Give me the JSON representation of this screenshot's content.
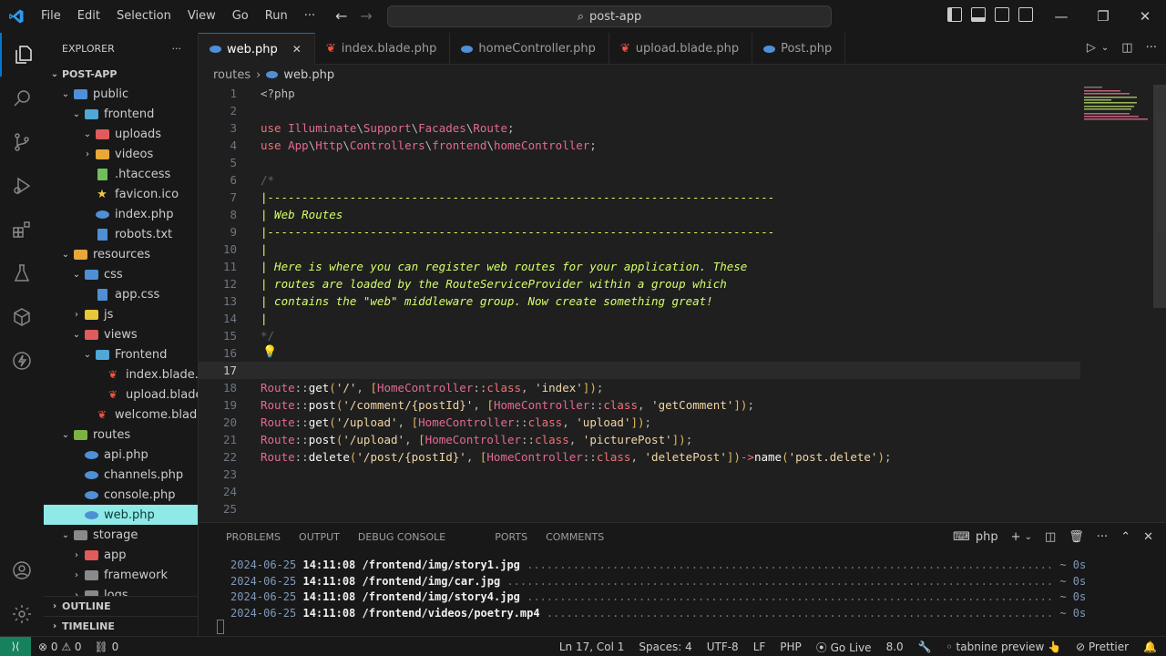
{
  "titlebar": {
    "menu": [
      "File",
      "Edit",
      "Selection",
      "View",
      "Go",
      "Run",
      "···"
    ],
    "search": "post-app"
  },
  "explorer": {
    "header": "EXPLORER",
    "more": "···",
    "project": "POST-APP",
    "tree": [
      {
        "label": "public",
        "kind": "folder-open",
        "indent": 1,
        "color": "#4f8fd6"
      },
      {
        "label": "frontend",
        "kind": "folder-open",
        "indent": 2,
        "color": "#4fa8d6"
      },
      {
        "label": "uploads",
        "kind": "folder-open",
        "indent": 3,
        "color": "#e05b5b"
      },
      {
        "label": "videos",
        "kind": "folder",
        "indent": 3,
        "color": "#e8a838"
      },
      {
        "label": ".htaccess",
        "kind": "file-ht",
        "indent": 3
      },
      {
        "label": "favicon.ico",
        "kind": "file-star",
        "indent": 3
      },
      {
        "label": "index.php",
        "kind": "file-php",
        "indent": 3
      },
      {
        "label": "robots.txt",
        "kind": "file-txt",
        "indent": 3
      },
      {
        "label": "resources",
        "kind": "folder-open",
        "indent": 1,
        "color": "#e8a838"
      },
      {
        "label": "css",
        "kind": "folder-open",
        "indent": 2,
        "color": "#4f8fd6"
      },
      {
        "label": "app.css",
        "kind": "file-css",
        "indent": 3
      },
      {
        "label": "js",
        "kind": "folder",
        "indent": 2,
        "color": "#e8c838"
      },
      {
        "label": "views",
        "kind": "folder-open",
        "indent": 2,
        "color": "#e05b5b"
      },
      {
        "label": "Frontend",
        "kind": "folder-open",
        "indent": 3,
        "color": "#4fa8d6"
      },
      {
        "label": "index.blade.p...",
        "kind": "file-blade",
        "indent": 4
      },
      {
        "label": "upload.blade....",
        "kind": "file-blade",
        "indent": 4
      },
      {
        "label": "welcome.blade...",
        "kind": "file-blade",
        "indent": 3
      },
      {
        "label": "routes",
        "kind": "folder-open",
        "indent": 1,
        "color": "#7cb342"
      },
      {
        "label": "api.php",
        "kind": "file-php",
        "indent": 2
      },
      {
        "label": "channels.php",
        "kind": "file-php",
        "indent": 2
      },
      {
        "label": "console.php",
        "kind": "file-php",
        "indent": 2
      },
      {
        "label": "web.php",
        "kind": "file-php",
        "indent": 2,
        "selected": true
      },
      {
        "label": "storage",
        "kind": "folder-open",
        "indent": 1,
        "color": "#8a8a8a"
      },
      {
        "label": "app",
        "kind": "folder",
        "indent": 2,
        "color": "#e05b5b"
      },
      {
        "label": "framework",
        "kind": "folder",
        "indent": 2,
        "color": "#8a8a8a"
      },
      {
        "label": "logs",
        "kind": "folder",
        "indent": 2,
        "color": "#8a8a8a"
      }
    ],
    "outline": "OUTLINE",
    "timeline": "TIMELINE"
  },
  "tabs": [
    {
      "label": "web.php",
      "icon": "php",
      "active": true
    },
    {
      "label": "index.blade.php",
      "icon": "blade"
    },
    {
      "label": "homeController.php",
      "icon": "php"
    },
    {
      "label": "upload.blade.php",
      "icon": "blade"
    },
    {
      "label": "Post.php",
      "icon": "php"
    }
  ],
  "breadcrumb": {
    "folder": "routes",
    "file": "web.php"
  },
  "editor": {
    "current_line": 17,
    "lines": [
      [
        [
          "c-plain",
          "<?php"
        ]
      ],
      [],
      [
        [
          "c-kw",
          "use "
        ],
        [
          "c-cls",
          "Illuminate"
        ],
        [
          "c-plain",
          "\\"
        ],
        [
          "c-cls",
          "Support"
        ],
        [
          "c-plain",
          "\\"
        ],
        [
          "c-cls",
          "Facades"
        ],
        [
          "c-plain",
          "\\"
        ],
        [
          "c-cls",
          "Route"
        ],
        [
          "c-plain",
          ";"
        ]
      ],
      [
        [
          "c-kw",
          "use "
        ],
        [
          "c-cls",
          "App"
        ],
        [
          "c-plain",
          "\\"
        ],
        [
          "c-cls",
          "Http"
        ],
        [
          "c-plain",
          "\\"
        ],
        [
          "c-cls",
          "Controllers"
        ],
        [
          "c-plain",
          "\\"
        ],
        [
          "c-cls",
          "frontend"
        ],
        [
          "c-plain",
          "\\"
        ],
        [
          "c-cls",
          "homeController"
        ],
        [
          "c-plain",
          ";"
        ]
      ],
      [],
      [
        [
          "c-cmtdim",
          "/*"
        ]
      ],
      [
        [
          "c-cmt",
          "|--------------------------------------------------------------------------"
        ]
      ],
      [
        [
          "c-cmt",
          "| Web Routes"
        ]
      ],
      [
        [
          "c-cmt",
          "|--------------------------------------------------------------------------"
        ]
      ],
      [
        [
          "c-cmt",
          "|"
        ]
      ],
      [
        [
          "c-cmt",
          "| Here is where you can register web routes for your application. These"
        ]
      ],
      [
        [
          "c-cmt",
          "| routes are loaded by the RouteServiceProvider within a group which"
        ]
      ],
      [
        [
          "c-cmt",
          "| contains the \"web\" middleware group. Now create something great!"
        ]
      ],
      [
        [
          "c-cmt",
          "|"
        ]
      ],
      [
        [
          "c-cmtdim",
          "*/"
        ]
      ],
      [],
      [],
      [
        [
          "c-cls",
          "Route"
        ],
        [
          "c-plain",
          "::"
        ],
        [
          "c-fn",
          "get"
        ],
        [
          "c-bracket",
          "("
        ],
        [
          "c-str",
          "'/'"
        ],
        [
          "c-plain",
          ", "
        ],
        [
          "c-bracket",
          "["
        ],
        [
          "c-cls",
          "HomeController"
        ],
        [
          "c-plain",
          "::"
        ],
        [
          "c-kw",
          "class"
        ],
        [
          "c-plain",
          ", "
        ],
        [
          "c-str",
          "'index'"
        ],
        [
          "c-bracket",
          "])"
        ],
        [
          "c-plain",
          ";"
        ]
      ],
      [
        [
          "c-cls",
          "Route"
        ],
        [
          "c-plain",
          "::"
        ],
        [
          "c-fn",
          "post"
        ],
        [
          "c-bracket",
          "("
        ],
        [
          "c-str",
          "'/comment/{postId}'"
        ],
        [
          "c-plain",
          ", "
        ],
        [
          "c-bracket",
          "["
        ],
        [
          "c-cls",
          "HomeController"
        ],
        [
          "c-plain",
          "::"
        ],
        [
          "c-kw",
          "class"
        ],
        [
          "c-plain",
          ", "
        ],
        [
          "c-str",
          "'getComment'"
        ],
        [
          "c-bracket",
          "])"
        ],
        [
          "c-plain",
          ";"
        ]
      ],
      [
        [
          "c-cls",
          "Route"
        ],
        [
          "c-plain",
          "::"
        ],
        [
          "c-fn",
          "get"
        ],
        [
          "c-bracket",
          "("
        ],
        [
          "c-str",
          "'/upload'"
        ],
        [
          "c-plain",
          ", "
        ],
        [
          "c-bracket",
          "["
        ],
        [
          "c-cls",
          "HomeController"
        ],
        [
          "c-plain",
          "::"
        ],
        [
          "c-kw",
          "class"
        ],
        [
          "c-plain",
          ", "
        ],
        [
          "c-str",
          "'upload'"
        ],
        [
          "c-bracket",
          "])"
        ],
        [
          "c-plain",
          ";"
        ]
      ],
      [
        [
          "c-cls",
          "Route"
        ],
        [
          "c-plain",
          "::"
        ],
        [
          "c-fn",
          "post"
        ],
        [
          "c-bracket",
          "("
        ],
        [
          "c-str",
          "'/upload'"
        ],
        [
          "c-plain",
          ", "
        ],
        [
          "c-bracket",
          "["
        ],
        [
          "c-cls",
          "HomeController"
        ],
        [
          "c-plain",
          "::"
        ],
        [
          "c-kw",
          "class"
        ],
        [
          "c-plain",
          ", "
        ],
        [
          "c-str",
          "'picturePost'"
        ],
        [
          "c-bracket",
          "])"
        ],
        [
          "c-plain",
          ";"
        ]
      ],
      [
        [
          "c-cls",
          "Route"
        ],
        [
          "c-plain",
          "::"
        ],
        [
          "c-fn",
          "delete"
        ],
        [
          "c-bracket",
          "("
        ],
        [
          "c-str",
          "'/post/{postId}'"
        ],
        [
          "c-plain",
          ", "
        ],
        [
          "c-bracket",
          "["
        ],
        [
          "c-cls",
          "HomeController"
        ],
        [
          "c-plain",
          "::"
        ],
        [
          "c-kw",
          "class"
        ],
        [
          "c-plain",
          ", "
        ],
        [
          "c-str",
          "'deletePost'"
        ],
        [
          "c-bracket",
          "])"
        ],
        [
          "c-kw",
          "->"
        ],
        [
          "c-fn",
          "name"
        ],
        [
          "c-bracket",
          "("
        ],
        [
          "c-str",
          "'post.delete'"
        ],
        [
          "c-bracket",
          ")"
        ],
        [
          "c-plain",
          ";"
        ]
      ],
      [],
      [],
      []
    ]
  },
  "panel": {
    "tabs": [
      "PROBLEMS",
      "OUTPUT",
      "DEBUG CONSOLE",
      "PORTS",
      "COMMENTS"
    ],
    "terminal_name": "php",
    "log": [
      {
        "date": "2024-06-25",
        "time": "14:11:08",
        "path": "/frontend/img/story1.jpg",
        "dur": "~ 0s"
      },
      {
        "date": "2024-06-25",
        "time": "14:11:08",
        "path": "/frontend/img/car.jpg",
        "dur": "~ 0s"
      },
      {
        "date": "2024-06-25",
        "time": "14:11:08",
        "path": "/frontend/img/story4.jpg",
        "dur": "~ 0s"
      },
      {
        "date": "2024-06-25",
        "time": "14:11:08",
        "path": "/frontend/videos/poetry.mp4",
        "dur": "~ 0s"
      }
    ]
  },
  "statusbar": {
    "errors": "0",
    "warnings": "0",
    "ports": "0",
    "position": "Ln 17, Col 1",
    "spaces": "Spaces: 4",
    "encoding": "UTF-8",
    "eol": "LF",
    "language": "PHP",
    "golive": "Go Live",
    "version": "8.0",
    "tabnine": "tabnine preview",
    "prettier": "Prettier"
  },
  "colors": {
    "accent": "#0078d4",
    "remote": "#16825d",
    "selected_file": "#8fe9e7"
  }
}
